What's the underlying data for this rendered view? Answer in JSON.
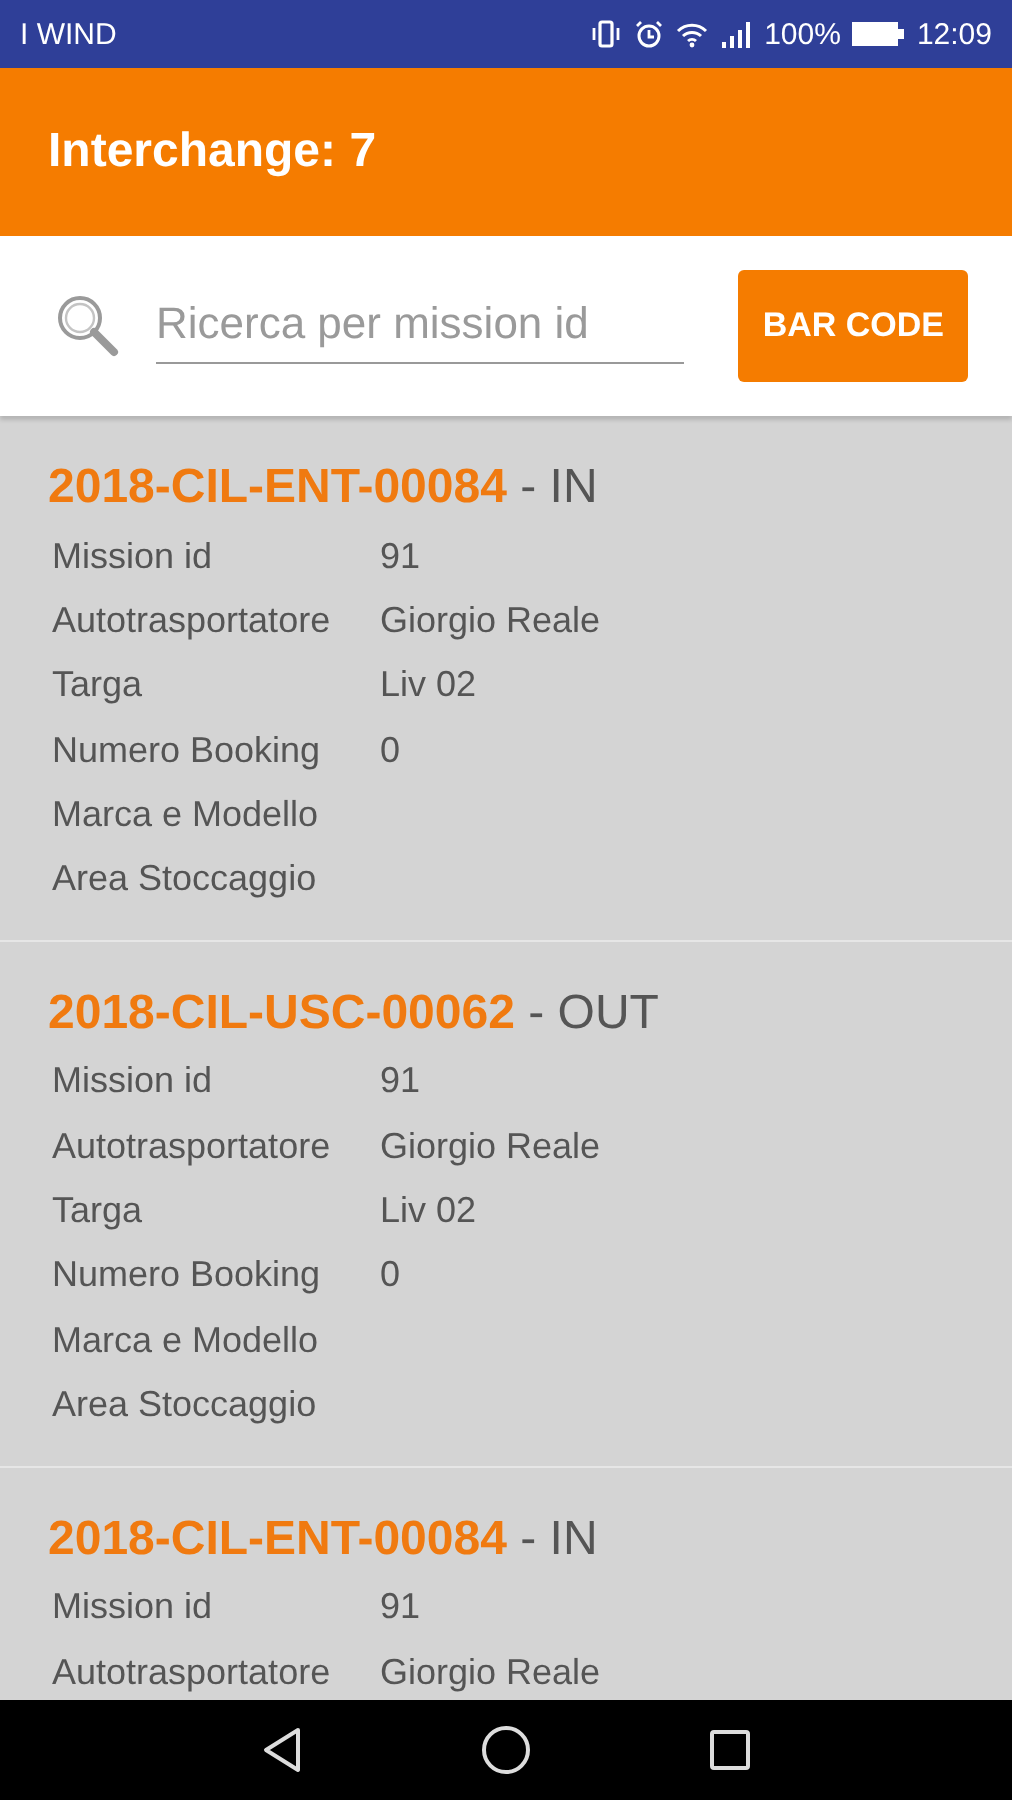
{
  "status_bar": {
    "carrier": "I WIND",
    "battery": "100%",
    "time": "12:09"
  },
  "app_bar": {
    "title": "Interchange: 7"
  },
  "search": {
    "placeholder": "Ricerca per mission id",
    "button": "BAR CODE"
  },
  "missions": [
    {
      "code": "2018-CIL-ENT-00084",
      "direction": "- IN",
      "fields": [
        {
          "label": "Mission id",
          "value": "91"
        },
        {
          "label": "Autotrasportatore",
          "value": "Giorgio Reale"
        },
        {
          "label": "Targa",
          "value": "Liv 02"
        },
        {
          "label": "Numero Booking",
          "value": "0"
        },
        {
          "label": "Marca e Modello"
        },
        {
          "label": "Area Stoccaggio"
        }
      ]
    },
    {
      "code": "2018-CIL-USC-00062",
      "direction": "- OUT",
      "fields": [
        {
          "label": "Mission id",
          "value": "91"
        },
        {
          "label": "Autotrasportatore",
          "value": "Giorgio Reale"
        },
        {
          "label": "Targa",
          "value": "Liv 02"
        },
        {
          "label": "Numero Booking",
          "value": "0"
        },
        {
          "label": "Marca e Modello"
        },
        {
          "label": "Area Stoccaggio"
        }
      ]
    },
    {
      "code": "2018-CIL-ENT-00084",
      "direction": "- IN",
      "fields": [
        {
          "label": "Mission id",
          "value": "91"
        },
        {
          "label": "Autotrasportatore",
          "value": "Giorgio Reale"
        }
      ]
    }
  ]
}
